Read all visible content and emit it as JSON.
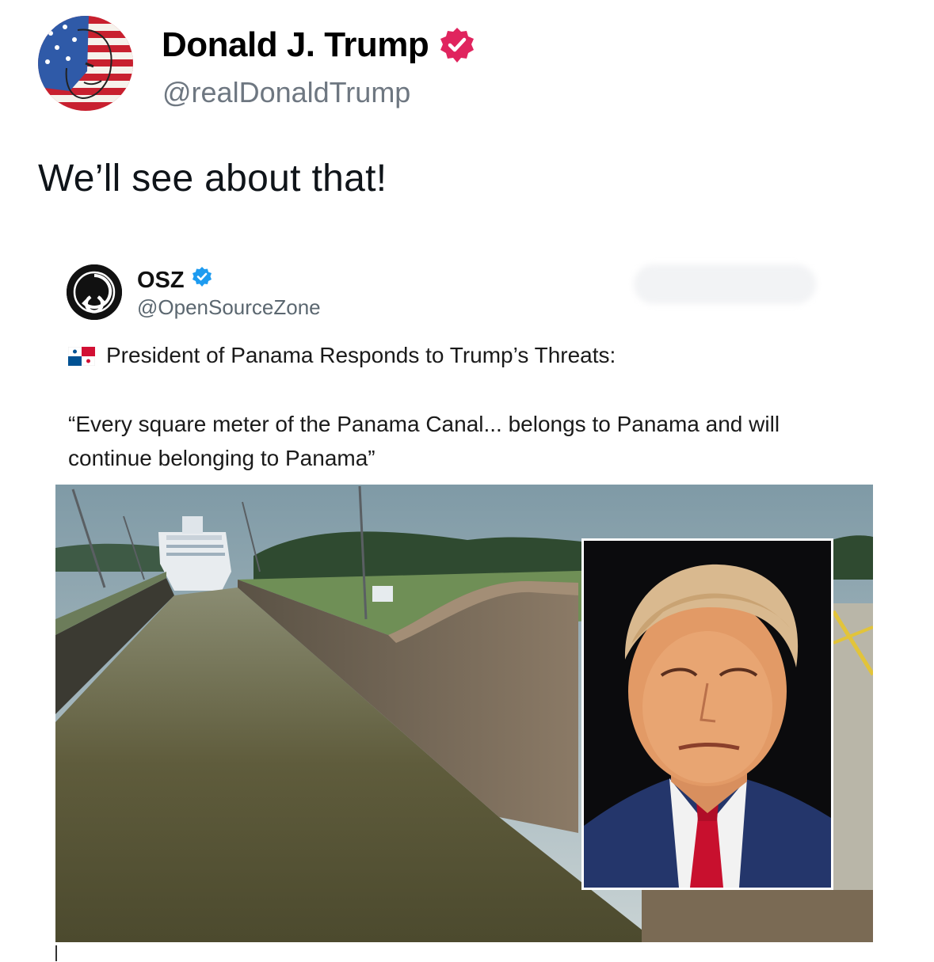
{
  "post": {
    "author": {
      "name": "Donald J. Trump",
      "handle": "@realDonaldTrump",
      "verified": true,
      "badge_color": "#e0245e",
      "avatar": "american-flag-painted-face-avatar"
    },
    "text": "We’ll see about that!"
  },
  "embedded_post": {
    "author": {
      "name": "OSZ",
      "handle": "@OpenSourceZone",
      "verified": true,
      "badge_color": "#1d9bf0",
      "avatar": "open-source-logo-icon"
    },
    "headline_flag": "panama-flag-icon",
    "headline": "President of Panama Responds to Trump’s Threats:",
    "quote": "“Every square meter of the Panama Canal... belongs to Panama and will continue belonging to Panama”",
    "image": {
      "scene": "panama-canal-locks-cruise-ship-photo",
      "inset": "trump-portrait-photo"
    }
  }
}
